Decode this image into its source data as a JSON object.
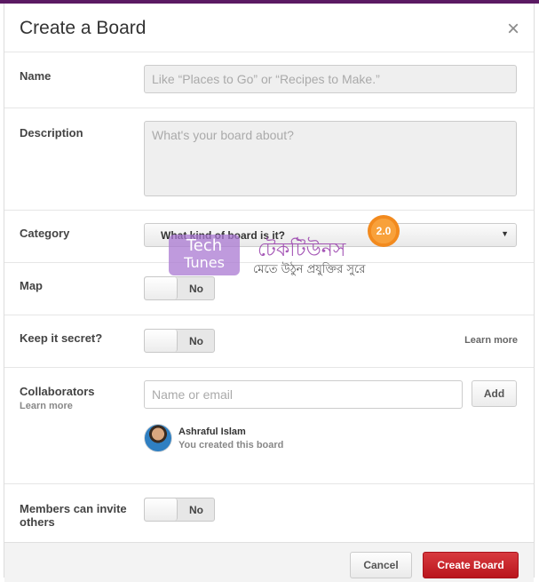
{
  "dialog": {
    "title": "Create a Board",
    "close_glyph": "×"
  },
  "fields": {
    "name": {
      "label": "Name",
      "placeholder": "Like “Places to Go” or “Recipes to Make.”",
      "value": ""
    },
    "description": {
      "label": "Description",
      "placeholder": "What's your board about?",
      "value": ""
    },
    "category": {
      "label": "Category",
      "selected": "What kind of board is it?"
    },
    "map": {
      "label": "Map",
      "toggle": "No"
    },
    "secret": {
      "label": "Keep it secret?",
      "toggle": "No",
      "link": "Learn more"
    },
    "collaborators": {
      "label": "Collaborators",
      "link": "Learn more",
      "placeholder": "Name or email",
      "add_label": "Add",
      "users": [
        {
          "name": "Ashraful Islam",
          "note": "You created this board"
        }
      ]
    },
    "members_invite": {
      "label": "Members can invite others",
      "toggle": "No"
    }
  },
  "footer": {
    "cancel_label": "Cancel",
    "create_label": "Create Board"
  },
  "watermark": {
    "logo_line1": "Tech",
    "logo_line2": "Tunes",
    "bangla_name": "টেকটিউনস",
    "tagline": "মেতে উঠুন প্রযুক্তির সুরে",
    "badge": "2.0"
  },
  "colors": {
    "top_bar": "#5b1a63",
    "primary_button": "#c0141b"
  },
  "icons": {
    "close": "close-icon",
    "dropdown": "chevron-down-icon",
    "avatar": "user-avatar"
  }
}
